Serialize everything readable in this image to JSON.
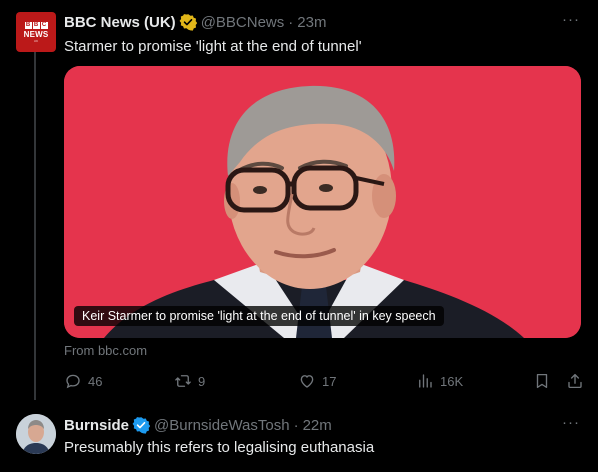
{
  "tweet": {
    "author_name": "BBC News (UK)",
    "handle": "@BBCNews",
    "separator": "·",
    "time": "23m",
    "text": "Starmer to promise 'light at the end of tunnel'",
    "more_label": "···",
    "avatar": {
      "blocks": [
        "B",
        "B",
        "C"
      ],
      "name": "NEWS",
      "small": "UK"
    },
    "card": {
      "caption": "Keir Starmer to promise 'light at the end of tunnel' in key speech",
      "source": "From bbc.com",
      "background_color": "#e5344d"
    },
    "actions": {
      "replies": "46",
      "retweets": "9",
      "likes": "17",
      "views": "16K"
    },
    "verified_badge_color": "#e2b719"
  },
  "reply": {
    "author_name": "Burnside",
    "handle": "@BurnsideWasTosh",
    "separator": "·",
    "time": "22m",
    "text": "Presumably this refers to legalising euthanasia",
    "more_label": "···",
    "verified_badge_color": "#1d9bf0"
  },
  "icons": {
    "reply": "speech-bubble-icon",
    "retweet": "retweet-icon",
    "like": "heart-icon",
    "views": "bar-chart-icon",
    "bookmark": "bookmark-icon",
    "share": "share-icon"
  }
}
